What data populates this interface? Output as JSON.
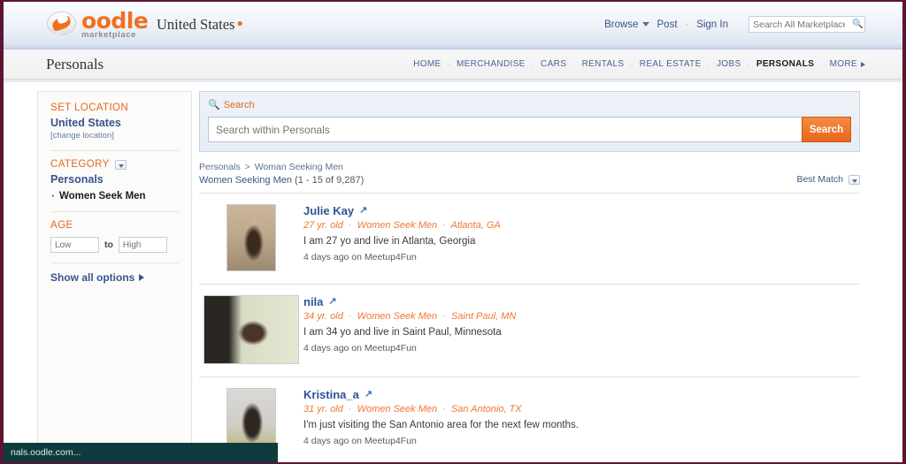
{
  "header": {
    "logo_word": "oodle",
    "logo_sub": "marketplace",
    "logo_icon": "oodle-speech-bubble-logo",
    "location": "United States",
    "pin_icon": "location-pin-icon",
    "browse_label": "Browse",
    "post_label": "Post",
    "separator": "·",
    "signin_label": "Sign In",
    "search_placeholder": "Search All Marketplace",
    "search_value": "",
    "search_icon": "magnifier-icon"
  },
  "subheader": {
    "title": "Personals",
    "nav": [
      {
        "label": "HOME",
        "active": false
      },
      {
        "label": "MERCHANDISE",
        "active": false
      },
      {
        "label": "CARS",
        "active": false
      },
      {
        "label": "RENTALS",
        "active": false
      },
      {
        "label": "REAL ESTATE",
        "active": false
      },
      {
        "label": "JOBS",
        "active": false
      },
      {
        "label": "PERSONALS",
        "active": true
      },
      {
        "label": "MORE",
        "active": false
      }
    ],
    "nav_separator": "·"
  },
  "sidebar": {
    "location_heading": "SET LOCATION",
    "location_value": "United States",
    "change_location": "[change location]",
    "category_heading": "CATEGORY",
    "category_value": "Personals",
    "category_sub": "Women Seek Men",
    "age_heading": "AGE",
    "age_low_placeholder": "Low",
    "age_low_value": "",
    "age_to": "to",
    "age_high_placeholder": "High",
    "age_high_value": "",
    "show_all_options": "Show all options"
  },
  "search_panel": {
    "label": "Search",
    "magnifier_icon": "magnifier-icon",
    "input_placeholder": "Search within Personals",
    "input_value": "",
    "button_label": "Search"
  },
  "results": {
    "breadcrumb_root": "Personals",
    "breadcrumb_sep": ">",
    "breadcrumb_current": "Woman Seeking Men",
    "heading": "Women Seeking Men",
    "count": "(1 - 15 of 9,287)",
    "sort_label": "Best Match"
  },
  "listings": [
    {
      "name": "Julie Kay",
      "external_icon": "external-link-icon",
      "age": "27 yr. old",
      "category": "Women Seek Men",
      "location": "Atlanta, GA",
      "description": "I am 27 yo and live in Atlanta, Georgia",
      "source": "4 days ago on Meetup4Fun",
      "thumb_orientation": "portrait",
      "thumb_class": "photo-1"
    },
    {
      "name": "nila",
      "external_icon": "external-link-icon",
      "age": "34 yr. old",
      "category": "Women Seek Men",
      "location": "Saint Paul, MN",
      "description": "I am 34 yo and live in Saint Paul, Minnesota",
      "source": "4 days ago on Meetup4Fun",
      "thumb_orientation": "landscape",
      "thumb_class": "photo-2"
    },
    {
      "name": "Kristina_a",
      "external_icon": "external-link-icon",
      "age": "31 yr. old",
      "category": "Women Seek Men",
      "location": "San Antonio, TX",
      "description": "I'm just visiting the San Antonio area for the next few months.",
      "source": "4 days ago on Meetup4Fun",
      "thumb_orientation": "portrait",
      "thumb_class": "photo-3"
    }
  ],
  "status_bar": {
    "url_text": "nals.oodle.com..."
  },
  "colors": {
    "brand_orange": "#f07020",
    "link_blue": "#39558c",
    "meta_orange": "#ee7733",
    "frame_border": "#5c1435",
    "status_bg": "#0d3b3e"
  }
}
